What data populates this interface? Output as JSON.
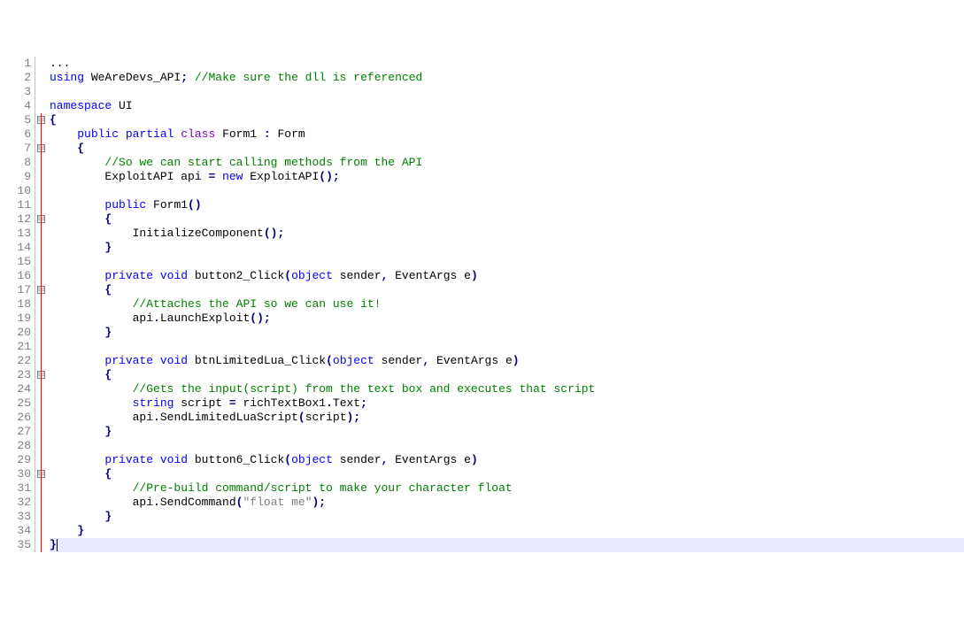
{
  "lines": [
    {
      "n": 1,
      "fold": null,
      "segs": [
        [
          "txt",
          "..."
        ]
      ]
    },
    {
      "n": 2,
      "fold": null,
      "segs": [
        [
          "kw",
          "using"
        ],
        [
          "txt",
          " WeAreDevs_API"
        ],
        [
          "pun",
          ";"
        ],
        [
          "txt",
          " "
        ],
        [
          "cmt",
          "//Make sure the dll is referenced"
        ]
      ]
    },
    {
      "n": 3,
      "fold": null,
      "segs": []
    },
    {
      "n": 4,
      "fold": null,
      "segs": [
        [
          "kw",
          "namespace"
        ],
        [
          "txt",
          " UI"
        ]
      ]
    },
    {
      "n": 5,
      "fold": "box",
      "segs": [
        [
          "pun",
          "{"
        ]
      ]
    },
    {
      "n": 6,
      "fold": "line",
      "segs": [
        [
          "txt",
          "    "
        ],
        [
          "kw",
          "public"
        ],
        [
          "txt",
          " "
        ],
        [
          "kw",
          "partial"
        ],
        [
          "txt",
          " "
        ],
        [
          "cls",
          "class"
        ],
        [
          "txt",
          " Form1 "
        ],
        [
          "pun",
          ":"
        ],
        [
          "txt",
          " Form"
        ]
      ]
    },
    {
      "n": 7,
      "fold": "box",
      "segs": [
        [
          "txt",
          "    "
        ],
        [
          "pun",
          "{"
        ]
      ]
    },
    {
      "n": 8,
      "fold": "line",
      "segs": [
        [
          "txt",
          "        "
        ],
        [
          "cmt",
          "//So we can start calling methods from the API"
        ]
      ]
    },
    {
      "n": 9,
      "fold": "line",
      "segs": [
        [
          "txt",
          "        ExploitAPI api "
        ],
        [
          "pun",
          "="
        ],
        [
          "txt",
          " "
        ],
        [
          "kw",
          "new"
        ],
        [
          "txt",
          " ExploitAPI"
        ],
        [
          "pun",
          "();"
        ]
      ]
    },
    {
      "n": 10,
      "fold": "line",
      "segs": []
    },
    {
      "n": 11,
      "fold": "line",
      "segs": [
        [
          "txt",
          "        "
        ],
        [
          "kw",
          "public"
        ],
        [
          "txt",
          " Form1"
        ],
        [
          "pun",
          "()"
        ]
      ]
    },
    {
      "n": 12,
      "fold": "box",
      "segs": [
        [
          "txt",
          "        "
        ],
        [
          "pun",
          "{"
        ]
      ]
    },
    {
      "n": 13,
      "fold": "line",
      "segs": [
        [
          "txt",
          "            InitializeComponent"
        ],
        [
          "pun",
          "();"
        ]
      ]
    },
    {
      "n": 14,
      "fold": "line",
      "segs": [
        [
          "txt",
          "        "
        ],
        [
          "pun",
          "}"
        ]
      ]
    },
    {
      "n": 15,
      "fold": "line",
      "segs": []
    },
    {
      "n": 16,
      "fold": "line",
      "segs": [
        [
          "txt",
          "        "
        ],
        [
          "kw",
          "private"
        ],
        [
          "txt",
          " "
        ],
        [
          "kw",
          "void"
        ],
        [
          "txt",
          " button2_Click"
        ],
        [
          "pun",
          "("
        ],
        [
          "kw",
          "object"
        ],
        [
          "txt",
          " sender"
        ],
        [
          "pun",
          ","
        ],
        [
          "txt",
          " EventArgs e"
        ],
        [
          "pun",
          ")"
        ]
      ]
    },
    {
      "n": 17,
      "fold": "box",
      "segs": [
        [
          "txt",
          "        "
        ],
        [
          "pun",
          "{"
        ]
      ]
    },
    {
      "n": 18,
      "fold": "line",
      "segs": [
        [
          "txt",
          "            "
        ],
        [
          "cmt",
          "//Attaches the API so we can use it!"
        ]
      ]
    },
    {
      "n": 19,
      "fold": "line",
      "segs": [
        [
          "txt",
          "            api"
        ],
        [
          "pun",
          "."
        ],
        [
          "txt",
          "LaunchExploit"
        ],
        [
          "pun",
          "();"
        ]
      ]
    },
    {
      "n": 20,
      "fold": "line",
      "segs": [
        [
          "txt",
          "        "
        ],
        [
          "pun",
          "}"
        ]
      ]
    },
    {
      "n": 21,
      "fold": "line",
      "segs": []
    },
    {
      "n": 22,
      "fold": "line",
      "segs": [
        [
          "txt",
          "        "
        ],
        [
          "kw",
          "private"
        ],
        [
          "txt",
          " "
        ],
        [
          "kw",
          "void"
        ],
        [
          "txt",
          " btnLimitedLua_Click"
        ],
        [
          "pun",
          "("
        ],
        [
          "kw",
          "object"
        ],
        [
          "txt",
          " sender"
        ],
        [
          "pun",
          ","
        ],
        [
          "txt",
          " EventArgs e"
        ],
        [
          "pun",
          ")"
        ]
      ]
    },
    {
      "n": 23,
      "fold": "box",
      "segs": [
        [
          "txt",
          "        "
        ],
        [
          "pun",
          "{"
        ]
      ]
    },
    {
      "n": 24,
      "fold": "line",
      "segs": [
        [
          "txt",
          "            "
        ],
        [
          "cmt",
          "//Gets the input(script) from the text box and executes that script"
        ]
      ]
    },
    {
      "n": 25,
      "fold": "line",
      "segs": [
        [
          "txt",
          "            "
        ],
        [
          "kw",
          "string"
        ],
        [
          "txt",
          " script "
        ],
        [
          "pun",
          "="
        ],
        [
          "txt",
          " richTextBox1"
        ],
        [
          "pun",
          "."
        ],
        [
          "txt",
          "Text"
        ],
        [
          "pun",
          ";"
        ]
      ]
    },
    {
      "n": 26,
      "fold": "line",
      "segs": [
        [
          "txt",
          "            api"
        ],
        [
          "pun",
          "."
        ],
        [
          "txt",
          "SendLimitedLuaScript"
        ],
        [
          "pun",
          "("
        ],
        [
          "txt",
          "script"
        ],
        [
          "pun",
          ");"
        ]
      ]
    },
    {
      "n": 27,
      "fold": "line",
      "segs": [
        [
          "txt",
          "        "
        ],
        [
          "pun",
          "}"
        ]
      ]
    },
    {
      "n": 28,
      "fold": "line",
      "segs": []
    },
    {
      "n": 29,
      "fold": "line",
      "segs": [
        [
          "txt",
          "        "
        ],
        [
          "kw",
          "private"
        ],
        [
          "txt",
          " "
        ],
        [
          "kw",
          "void"
        ],
        [
          "txt",
          " button6_Click"
        ],
        [
          "pun",
          "("
        ],
        [
          "kw",
          "object"
        ],
        [
          "txt",
          " sender"
        ],
        [
          "pun",
          ","
        ],
        [
          "txt",
          " EventArgs e"
        ],
        [
          "pun",
          ")"
        ]
      ]
    },
    {
      "n": 30,
      "fold": "box",
      "segs": [
        [
          "txt",
          "        "
        ],
        [
          "pun",
          "{"
        ]
      ]
    },
    {
      "n": 31,
      "fold": "line",
      "segs": [
        [
          "txt",
          "            "
        ],
        [
          "cmt",
          "//Pre-build command/script to make your character float"
        ]
      ]
    },
    {
      "n": 32,
      "fold": "line",
      "segs": [
        [
          "txt",
          "            api"
        ],
        [
          "pun",
          "."
        ],
        [
          "txt",
          "SendCommand"
        ],
        [
          "pun",
          "("
        ],
        [
          "str",
          "\"float me\""
        ],
        [
          "pun",
          ");"
        ]
      ]
    },
    {
      "n": 33,
      "fold": "line",
      "segs": [
        [
          "txt",
          "        "
        ],
        [
          "pun",
          "}"
        ]
      ]
    },
    {
      "n": 34,
      "fold": "line",
      "segs": [
        [
          "txt",
          "    "
        ],
        [
          "pun",
          "}"
        ]
      ]
    },
    {
      "n": 35,
      "fold": "end",
      "highlight": true,
      "caret": true,
      "segs": [
        [
          "pun",
          "}"
        ]
      ]
    }
  ],
  "fold_glyph": "⊟"
}
